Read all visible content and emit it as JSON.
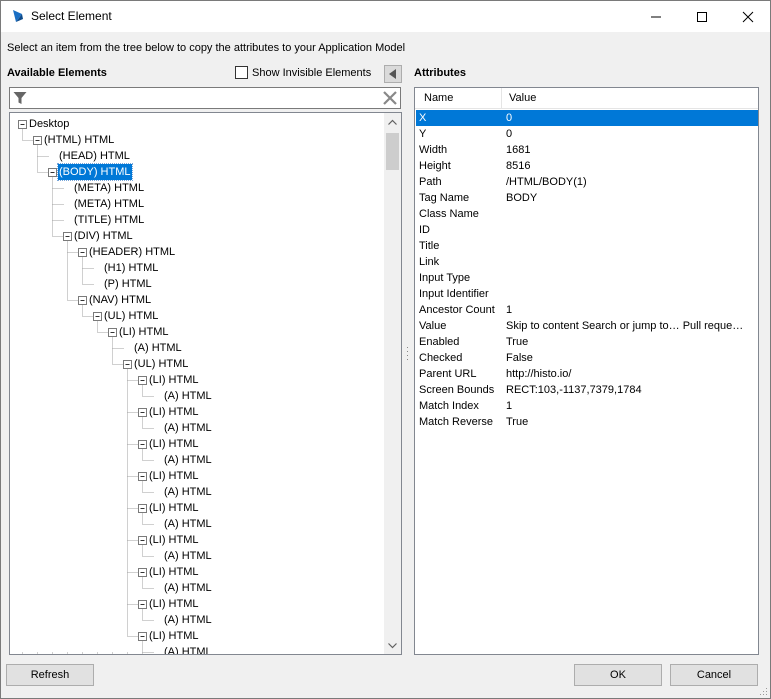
{
  "window": {
    "title": "Select Element",
    "icon": "app-logo-icon"
  },
  "instruction": "Select an item from the tree below to copy the attributes to your Application Model",
  "left": {
    "heading": "Available Elements",
    "show_invisible_label": "Show Invisible Elements",
    "show_invisible_checked": false,
    "filter_value": "",
    "tree": [
      {
        "label": "Desktop",
        "depth": 0,
        "expander": "minus"
      },
      {
        "label": "(HTML) HTML",
        "depth": 1,
        "expander": "minus"
      },
      {
        "label": "(HEAD) HTML",
        "depth": 2,
        "expander": "none"
      },
      {
        "label": "(BODY) HTML",
        "depth": 2,
        "expander": "minus",
        "selected": true
      },
      {
        "label": "(META) HTML",
        "depth": 3,
        "expander": "none"
      },
      {
        "label": "(META) HTML",
        "depth": 3,
        "expander": "none"
      },
      {
        "label": "(TITLE) HTML",
        "depth": 3,
        "expander": "none"
      },
      {
        "label": "(DIV) HTML",
        "depth": 3,
        "expander": "minus"
      },
      {
        "label": "(HEADER) HTML",
        "depth": 4,
        "expander": "minus"
      },
      {
        "label": "(H1) HTML",
        "depth": 5,
        "expander": "none"
      },
      {
        "label": "(P) HTML",
        "depth": 5,
        "expander": "none"
      },
      {
        "label": "(NAV) HTML",
        "depth": 4,
        "expander": "minus"
      },
      {
        "label": "(UL) HTML",
        "depth": 5,
        "expander": "minus"
      },
      {
        "label": "(LI) HTML",
        "depth": 6,
        "expander": "minus"
      },
      {
        "label": "(A) HTML",
        "depth": 7,
        "expander": "none"
      },
      {
        "label": "(UL) HTML",
        "depth": 7,
        "expander": "minus"
      },
      {
        "label": "(LI) HTML",
        "depth": 8,
        "expander": "minus"
      },
      {
        "label": "(A) HTML",
        "depth": 9,
        "expander": "none"
      },
      {
        "label": "(LI) HTML",
        "depth": 8,
        "expander": "minus"
      },
      {
        "label": "(A) HTML",
        "depth": 9,
        "expander": "none"
      },
      {
        "label": "(LI) HTML",
        "depth": 8,
        "expander": "minus"
      },
      {
        "label": "(A) HTML",
        "depth": 9,
        "expander": "none"
      },
      {
        "label": "(LI) HTML",
        "depth": 8,
        "expander": "minus"
      },
      {
        "label": "(A) HTML",
        "depth": 9,
        "expander": "none"
      },
      {
        "label": "(LI) HTML",
        "depth": 8,
        "expander": "minus"
      },
      {
        "label": "(A) HTML",
        "depth": 9,
        "expander": "none"
      },
      {
        "label": "(LI) HTML",
        "depth": 8,
        "expander": "minus"
      },
      {
        "label": "(A) HTML",
        "depth": 9,
        "expander": "none"
      },
      {
        "label": "(LI) HTML",
        "depth": 8,
        "expander": "minus"
      },
      {
        "label": "(A) HTML",
        "depth": 9,
        "expander": "none"
      },
      {
        "label": "(LI) HTML",
        "depth": 8,
        "expander": "minus"
      },
      {
        "label": "(A) HTML",
        "depth": 9,
        "expander": "none"
      },
      {
        "label": "(LI) HTML",
        "depth": 8,
        "expander": "minus"
      },
      {
        "label": "(A) HTML",
        "depth": 9,
        "expander": "none"
      }
    ]
  },
  "right": {
    "heading": "Attributes",
    "columns": {
      "name": "Name",
      "value": "Value"
    },
    "rows": [
      {
        "name": "X",
        "value": "0",
        "selected": true
      },
      {
        "name": "Y",
        "value": "0"
      },
      {
        "name": "Width",
        "value": "1681"
      },
      {
        "name": "Height",
        "value": "8516"
      },
      {
        "name": "Path",
        "value": "/HTML/BODY(1)"
      },
      {
        "name": "Tag Name",
        "value": "BODY"
      },
      {
        "name": "Class Name",
        "value": ""
      },
      {
        "name": "ID",
        "value": ""
      },
      {
        "name": "Title",
        "value": ""
      },
      {
        "name": "Link",
        "value": ""
      },
      {
        "name": "Input Type",
        "value": ""
      },
      {
        "name": "Input Identifier",
        "value": ""
      },
      {
        "name": "Ancestor Count",
        "value": "1"
      },
      {
        "name": "Value",
        "value": "Skip to content Search or jump to… Pull reque…"
      },
      {
        "name": "Enabled",
        "value": "True"
      },
      {
        "name": "Checked",
        "value": "False"
      },
      {
        "name": "Parent URL",
        "value": "http://histo.io/"
      },
      {
        "name": "Screen Bounds",
        "value": "RECT:103,-1137,7379,1784"
      },
      {
        "name": "Match Index",
        "value": "1"
      },
      {
        "name": "Match Reverse",
        "value": "True"
      }
    ]
  },
  "buttons": {
    "refresh": "Refresh",
    "ok": "OK",
    "cancel": "Cancel"
  },
  "colors": {
    "selection": "#0078d7",
    "window_bg": "#f0f0f0",
    "brand": "#1a6fc4"
  }
}
